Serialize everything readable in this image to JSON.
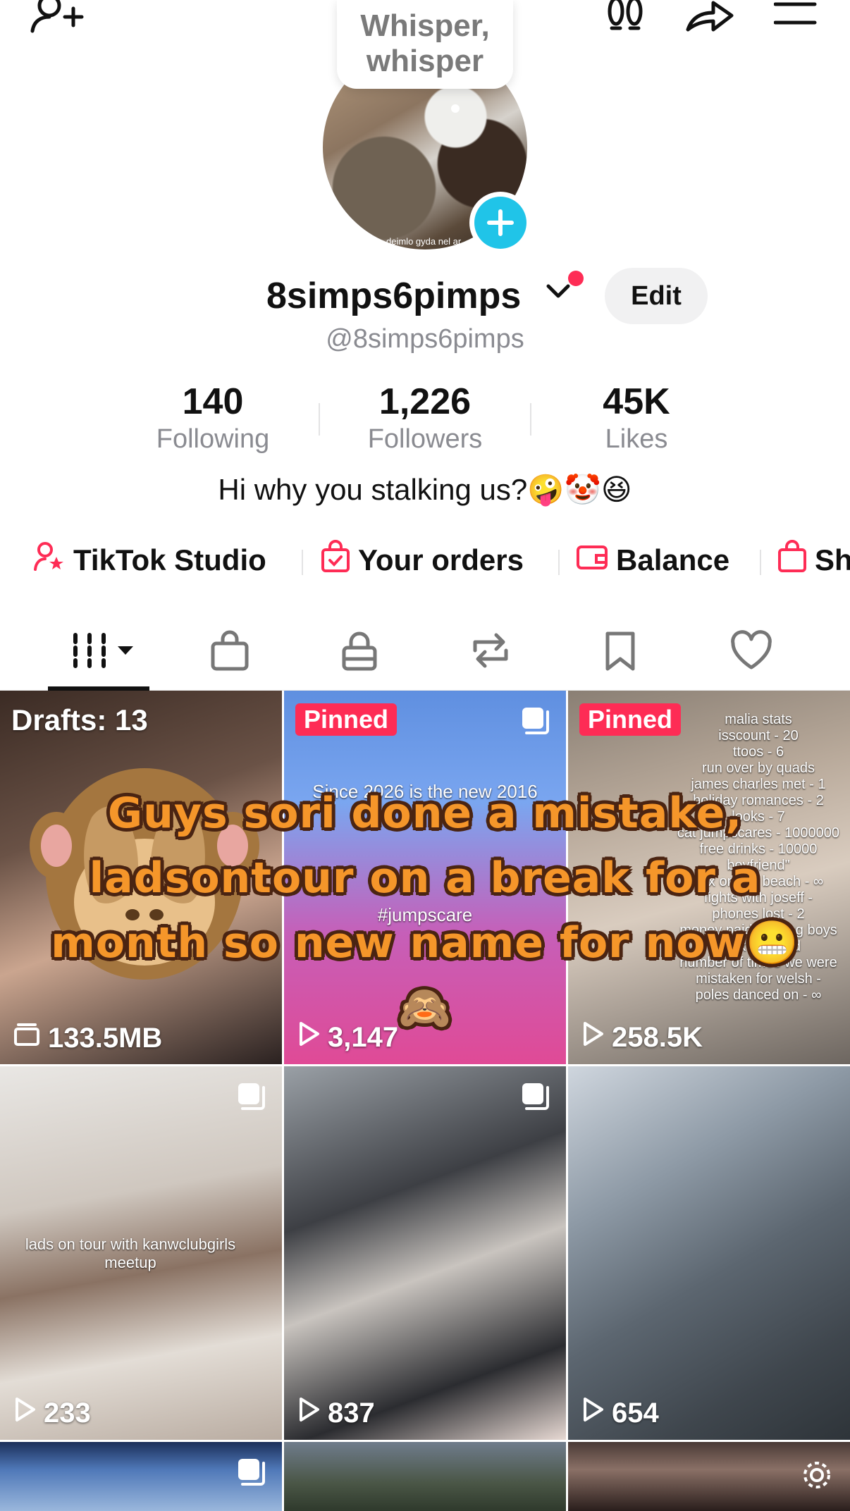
{
  "bubble": {
    "text": "Whisper, whisper"
  },
  "profile": {
    "avatar_caption": "deimlo gyda nel ar",
    "display_name": "8simps6pimps",
    "handle": "@8simps6pimps",
    "edit_label": "Edit",
    "bio": "Hi why you stalking us?🤪🤡😆"
  },
  "stats": [
    {
      "value": "140",
      "label": "Following"
    },
    {
      "value": "1,226",
      "label": "Followers"
    },
    {
      "value": "45K",
      "label": "Likes"
    }
  ],
  "quick_links": [
    {
      "label": "TikTok Studio",
      "icon": "person-star-icon"
    },
    {
      "label": "Your orders",
      "icon": "orders-bag-icon"
    },
    {
      "label": "Balance",
      "icon": "wallet-icon"
    },
    {
      "label": "Sh",
      "icon": "shop-bag-icon"
    }
  ],
  "tabs": [
    "videos-grid-icon",
    "shop-icon",
    "private-lock-icon",
    "repost-icon",
    "favorites-bookmark-icon",
    "liked-heart-icon"
  ],
  "grid": {
    "drafts_label": "Drafts: 13",
    "drafts_size": "133.5MB",
    "pinned_label": "Pinned",
    "items": [
      {
        "views": "3,147",
        "caption1": "Since 2026 is the new 2016",
        "caption2": "#jumpscare"
      },
      {
        "views": "258.5K",
        "title": "malia stats"
      },
      {
        "views": "233",
        "caption": "lads on tour with kanwclubgirls meetup"
      },
      {
        "views": "837"
      },
      {
        "views": "654"
      }
    ],
    "stats_lines": [
      "malia stats",
      "isscount - 20",
      "ttoos - 6",
      "run over by quads",
      "james charles met - 1",
      "holiday romances - 2",
      "looks - 7",
      "cat jumpscares - 1000000",
      "free drinks - 10000",
      "boyfriend\"",
      "sex on the beach - ∞",
      "fights with joseff -",
      "phones lost - 2",
      "money paid to bring boys back - 60quid",
      "number of times we were mistaken for welsh -",
      "poles danced on - ∞"
    ]
  },
  "announcement": "Guys sori done a mistake, ladsontour on a break for a month so new name for now😬🙈",
  "colors": {
    "accent": "#fe2c55",
    "add_button": "#20c4e8",
    "announcement_fill": "#f5962a",
    "announcement_outline": "#4a2412"
  }
}
